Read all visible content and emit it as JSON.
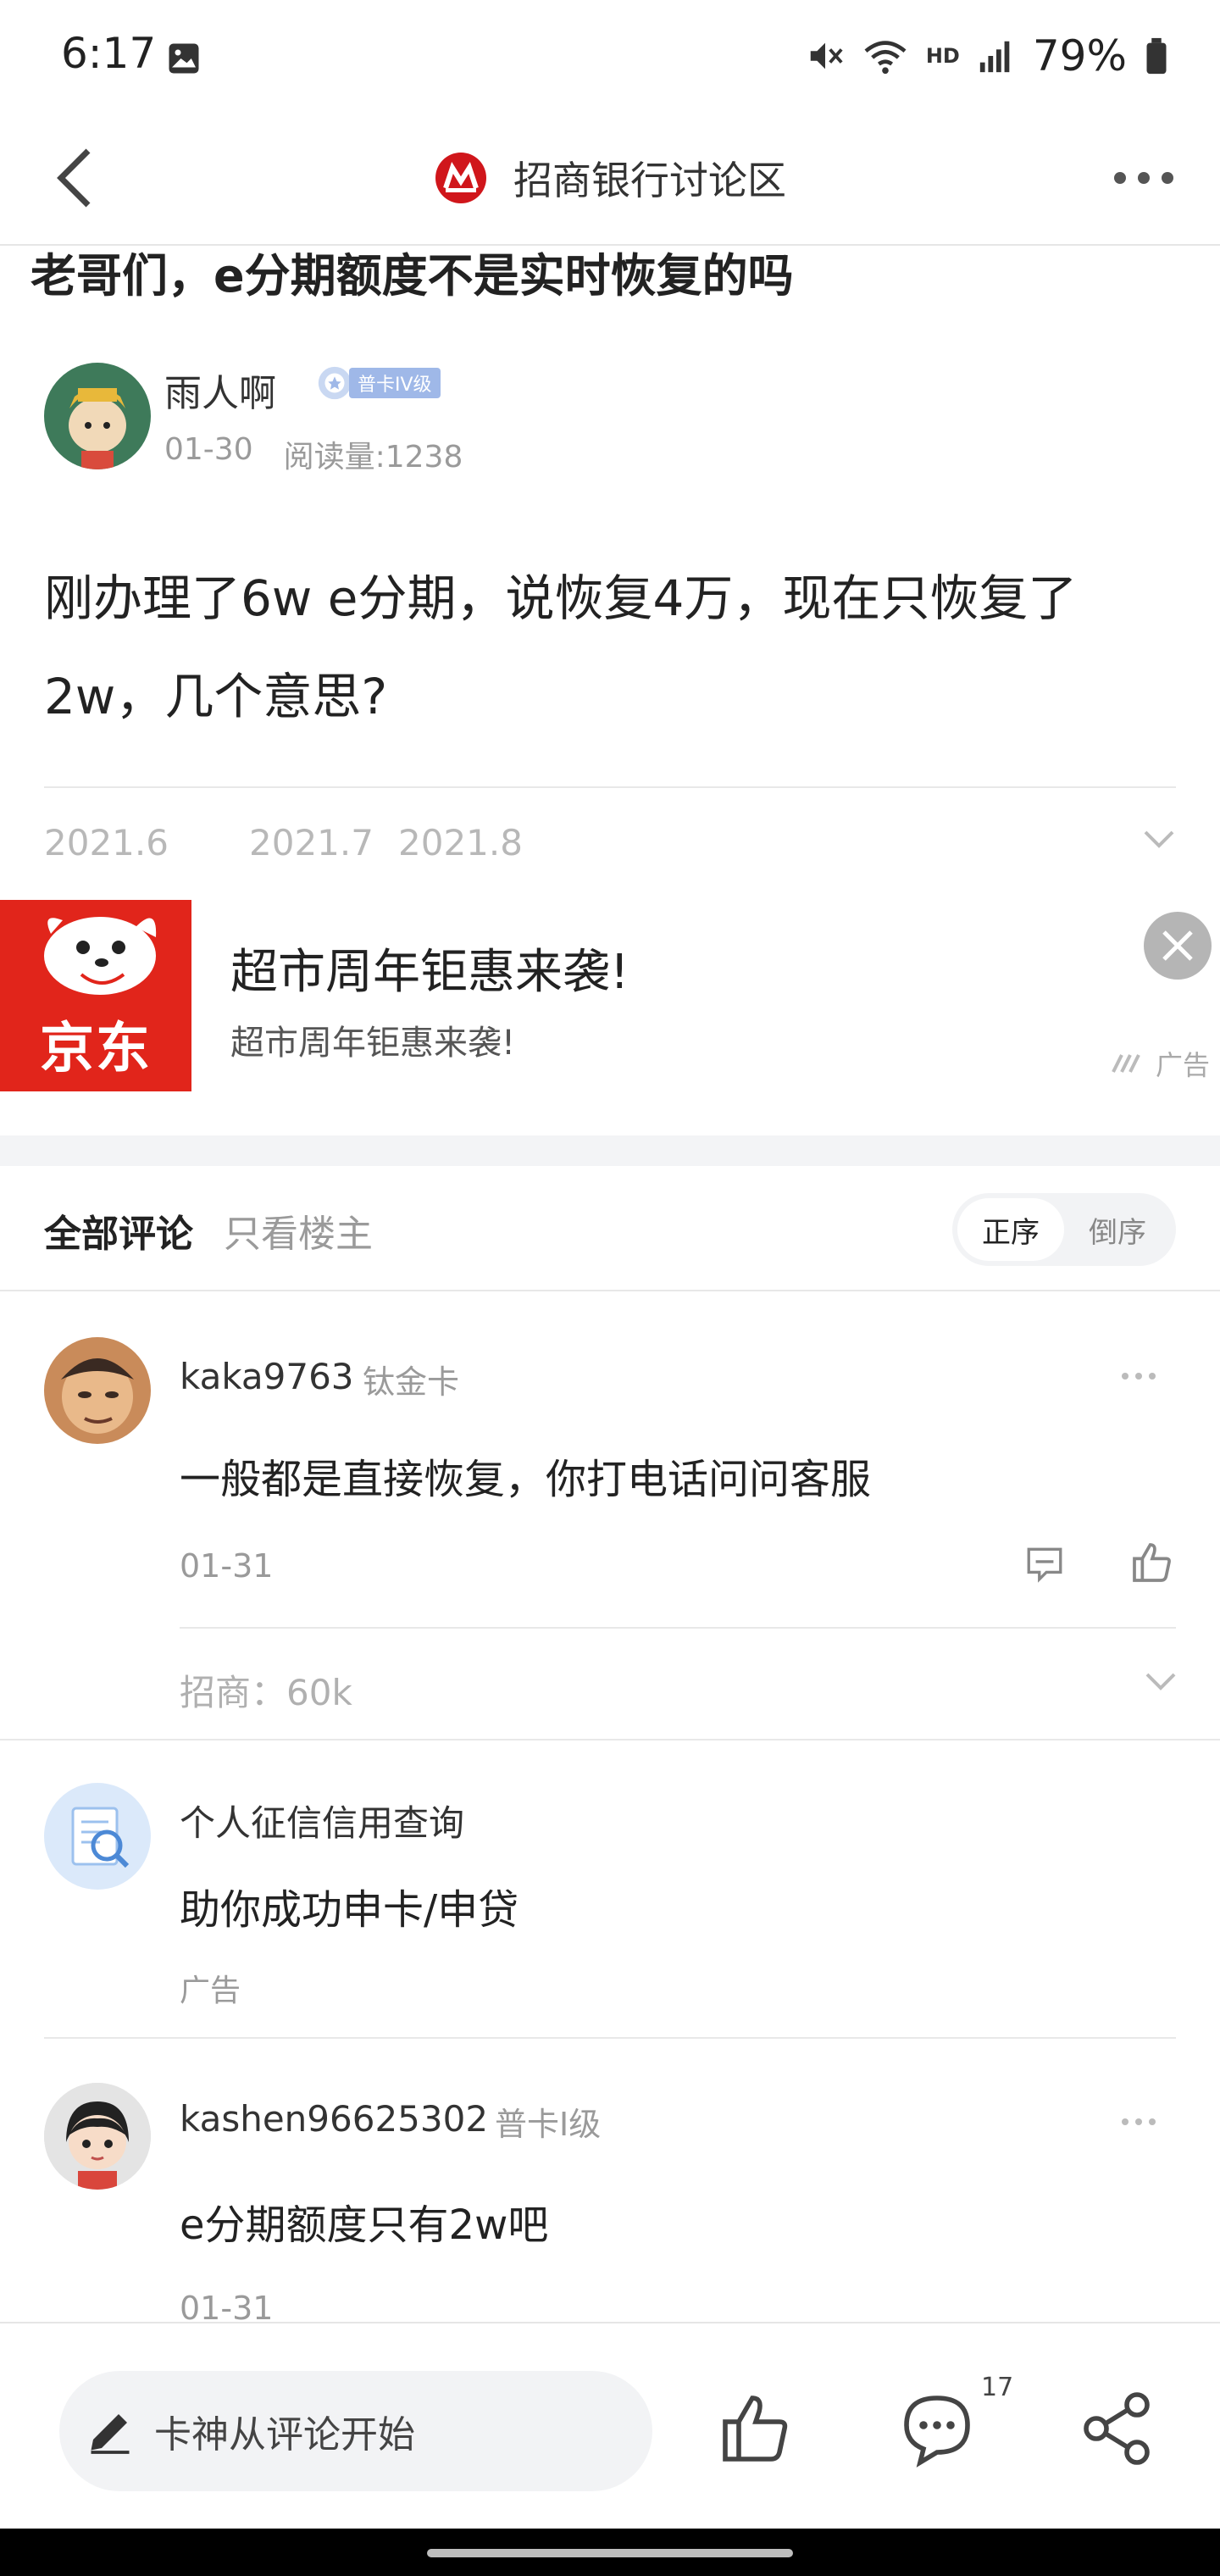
{
  "status_bar": {
    "time": "6:17",
    "battery": "79%",
    "network_label": "HD"
  },
  "header": {
    "title": "招商银行讨论区"
  },
  "post": {
    "title": "老哥们，e分期额度不是实时恢复的吗",
    "author": "雨人啊",
    "author_level": "普卡IV级",
    "date": "01-30",
    "read_count": "阅读量:1238",
    "body": "刚办理了6w e分期，说恢复4万，现在只恢复了2w，几个意思?",
    "attachments": [
      "2021.6",
      "2021.7",
      "2021.8"
    ]
  },
  "ad": {
    "brand": "京东",
    "title": "超市周年钜惠来袭!",
    "subtitle": "超市周年钜惠来袭!",
    "label": "广告"
  },
  "comments_header": {
    "tab_all": "全部评论",
    "tab_op_only": "只看楼主",
    "sort_asc": "正序",
    "sort_desc": "倒序"
  },
  "comments": [
    {
      "user": "kaka9763",
      "level": "钛金卡",
      "text": "一般都是直接恢复，你打电话问问客服",
      "date": "01-31",
      "tag": "招商：60k"
    },
    {
      "user": "kashen96625302",
      "level": "普卡I级",
      "text": "e分期额度只有2w吧",
      "date": "01-31"
    }
  ],
  "inline_ad": {
    "title": "个人征信信用查询",
    "text": "助你成功申卡/申贷",
    "label": "广告"
  },
  "bottom_bar": {
    "comment_placeholder": "卡神从评论开始",
    "comment_count": "17"
  },
  "colors": {
    "brand_red": "#e1251b",
    "level_badge": "#9fb8e8",
    "muted_text": "#9a9a9a"
  }
}
